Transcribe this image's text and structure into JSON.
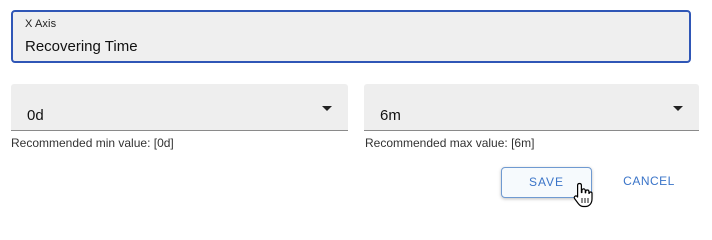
{
  "axis": {
    "label": "X Axis",
    "value": "Recovering Time"
  },
  "min_select": {
    "value": "0d",
    "helper": "Recommended min value: [0d]"
  },
  "max_select": {
    "value": "6m",
    "helper": "Recommended max value: [6m]"
  },
  "actions": {
    "save_label": "SAVE",
    "cancel_label": "CANCEL"
  },
  "colors": {
    "focus_border": "#2f56b6",
    "accent": "#3a74c8",
    "field_bg": "#eeeeee"
  },
  "icons": {
    "cursor": "hand-pointer-icon",
    "dropdown": "chevron-down-icon"
  }
}
